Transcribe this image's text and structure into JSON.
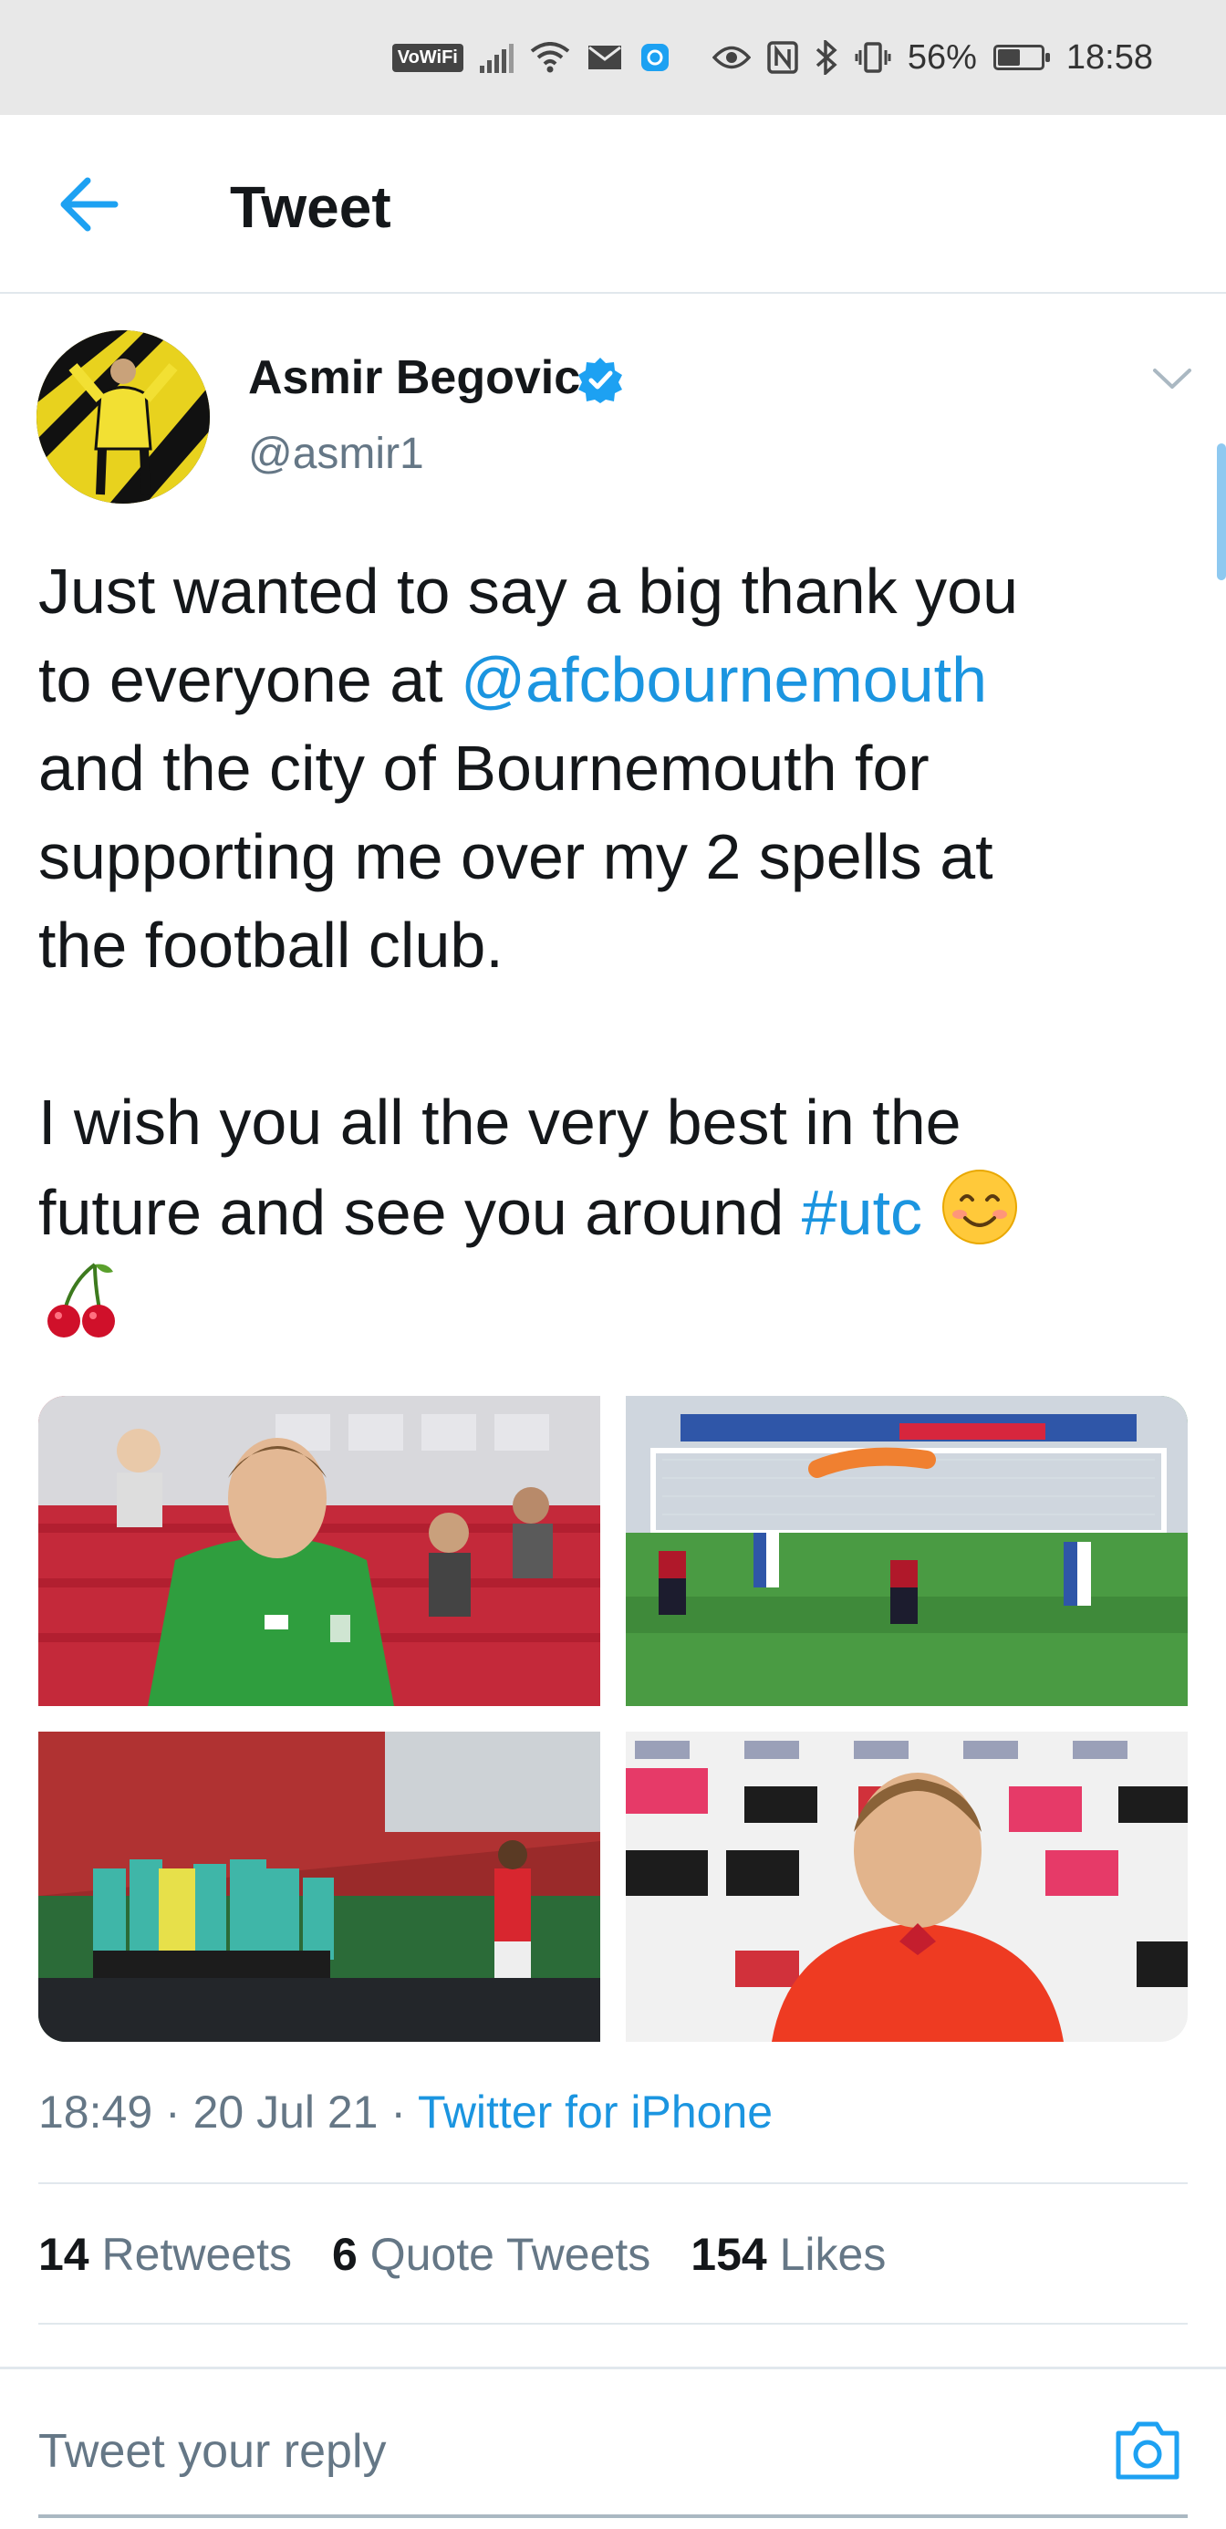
{
  "status_bar": {
    "vowifi": "VoWiFi",
    "battery_percent": "56%",
    "battery_level": 0.56,
    "time": "18:58",
    "icons": [
      "vowifi-icon",
      "signal-icon",
      "wifi-icon",
      "mail-icon",
      "notification-icon",
      "eye-icon",
      "nfc-icon",
      "bluetooth-icon",
      "vibrate-icon",
      "battery-icon"
    ]
  },
  "header": {
    "title": "Tweet",
    "back_icon": "arrow-left-icon"
  },
  "tweet": {
    "author": {
      "name": "Asmir Begovic",
      "handle": "@asmir1",
      "verified": true
    },
    "text_segments": [
      {
        "text": "Just wanted to say a big thank you\nto everyone at ",
        "link": false
      },
      {
        "text": "@afcbournemouth",
        "link": true
      },
      {
        "text": "\nand the city of Bournemouth for\nsupporting me over my 2 spells at\nthe football club.\n\nI wish you all the very best in the\nfuture and see you around ",
        "link": false
      },
      {
        "text": "#utc",
        "link": true
      },
      {
        "text": " ",
        "link": false
      }
    ],
    "emojis": [
      "smiling-face-with-smiling-eyes-emoji",
      "cherries-emoji"
    ],
    "media": [
      {
        "name": "photo-goalkeeper-green-shirt"
      },
      {
        "name": "photo-penalty-save"
      },
      {
        "name": "photo-team-huddle"
      },
      {
        "name": "photo-press-conference"
      }
    ],
    "time": "18:49",
    "date": "20 Jul 21",
    "source": "Twitter for iPhone",
    "separator": " · ",
    "stats": {
      "retweets_count": "14",
      "retweets_label": "Retweets",
      "quotes_count": "6",
      "quotes_label": "Quote Tweets",
      "likes_count": "154",
      "likes_label": "Likes"
    }
  },
  "reply": {
    "placeholder": "Tweet your reply",
    "camera_icon": "camera-icon"
  },
  "colors": {
    "link": "#1b95e0",
    "secondary_text": "#657786",
    "primary_text": "#14171a",
    "divider": "#e1e8ed",
    "status_bar_bg": "#e8e8e8"
  }
}
